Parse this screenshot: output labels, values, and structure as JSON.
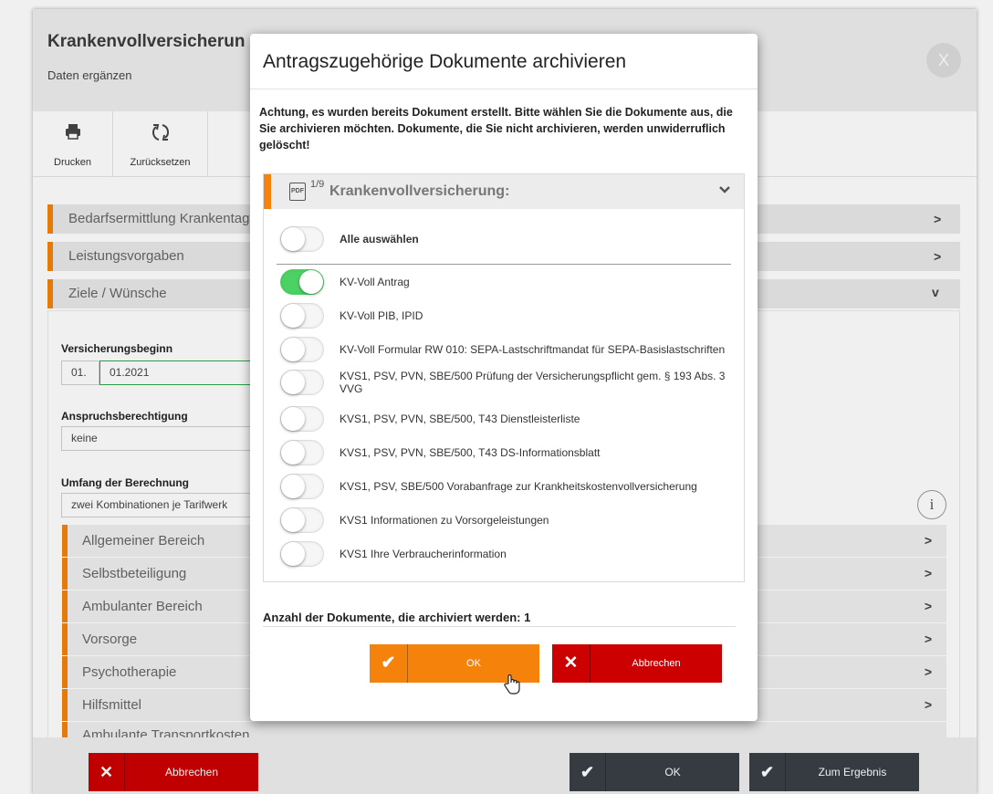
{
  "background": {
    "title": "Krankenvollversicherun",
    "subtitle": "Daten ergänzen",
    "close_glyph": "X",
    "toolbar": [
      {
        "label": "Drucken",
        "icon": "printer-icon"
      },
      {
        "label": "Zurücksetzen",
        "icon": "reset-icon"
      }
    ],
    "accordions": [
      {
        "label": "Bedarfsermittlung Krankentag",
        "chevron": ">"
      },
      {
        "label": "Leistungsvorgaben",
        "chevron": ">"
      },
      {
        "label": "Ziele / Wünsche",
        "chevron": "v"
      }
    ],
    "form": {
      "start_label": "Versicherungsbeginn",
      "start_day": "01.",
      "start_month_year": "01.2021",
      "entitlement_label": "Anspruchsberechtigung",
      "entitlement_value": "keine",
      "scope_label": "Umfang der Berechnung",
      "scope_value": "zwei Kombinationen je Tarifwerk",
      "info_glyph": "i"
    },
    "sections": [
      {
        "label": "Allgemeiner Bereich"
      },
      {
        "label": "Selbstbeteiligung"
      },
      {
        "label": "Ambulanter Bereich"
      },
      {
        "label": "Vorsorge"
      },
      {
        "label": "Psychotherapie"
      },
      {
        "label": "Hilfsmittel"
      },
      {
        "label": "Ambulante Transportkosten"
      }
    ],
    "footer": {
      "cancel_label": "Abbrechen",
      "ok_label": "OK",
      "result_label": "Zum Ergebnis"
    }
  },
  "modal": {
    "title": "Antragszugehörige Dokumente archivieren",
    "warning": "Achtung, es wurden bereits Dokument erstellt. Bitte wählen Sie die Dokumente aus, die Sie archivieren möchten. Dokumente, die Sie nicht archivieren, werden unwiderruflich gelöscht!",
    "group": {
      "pdf_icon_text": "PDF",
      "count": "1/9",
      "title": "Krankenvollversicherung:"
    },
    "select_all": {
      "label": "Alle auswählen",
      "checked": false
    },
    "documents": [
      {
        "label": "KV-Voll Antrag",
        "checked": true
      },
      {
        "label": "KV-Voll PIB, IPID",
        "checked": false
      },
      {
        "label": "KV-Voll Formular RW 010: SEPA-Lastschriftmandat für SEPA-Basislastschriften",
        "checked": false
      },
      {
        "label": "KVS1, PSV, PVN, SBE/500 Prüfung der Versicherungspflicht gem. § 193 Abs. 3 VVG",
        "checked": false
      },
      {
        "label": "KVS1, PSV, PVN, SBE/500, T43 Dienstleisterliste",
        "checked": false
      },
      {
        "label": "KVS1, PSV, PVN, SBE/500, T43 DS-Informationsblatt",
        "checked": false
      },
      {
        "label": "KVS1, PSV, SBE/500 Vorabanfrage zur Krankheitskostenvollversicherung",
        "checked": false
      },
      {
        "label": "KVS1 Informationen zu Vorsorgeleistungen",
        "checked": false
      },
      {
        "label": "KVS1 Ihre Verbraucherinformation",
        "checked": false
      }
    ],
    "count_label": "Anzahl der Dokumente, die archiviert werden: 1",
    "ok_label": "OK",
    "cancel_label": "Abbrechen"
  },
  "colors": {
    "accent_orange": "#f5820a",
    "danger_red": "#cc0000",
    "dark_button": "#3a3f46",
    "toggle_on": "#4cd164"
  }
}
